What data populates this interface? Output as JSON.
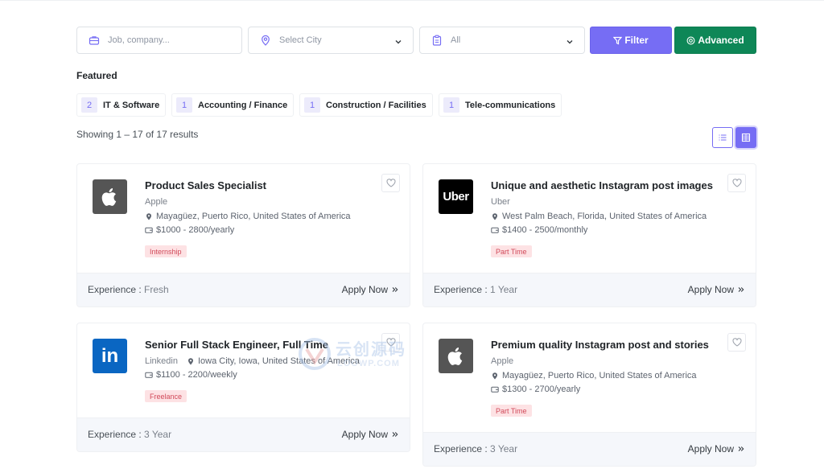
{
  "search": {
    "keyword_placeholder": "Job, company...",
    "city_value": "Select City",
    "category_value": "All",
    "filter_label": "Filter",
    "advanced_label": "Advanced"
  },
  "featured": {
    "title": "Featured",
    "chips": [
      {
        "count": "2",
        "name": "IT & Software"
      },
      {
        "count": "1",
        "name": "Accounting / Finance"
      },
      {
        "count": "1",
        "name": "Construction / Facilities"
      },
      {
        "count": "1",
        "name": "Tele-communications"
      }
    ]
  },
  "results": {
    "showing": "Showing 1 – 17 of 17 results"
  },
  "colors": {
    "accent": "#766df4",
    "advanced": "#0e8757",
    "tag_bg": "#fde2e4",
    "tag_text": "#d14a5a"
  },
  "jobs": [
    {
      "title": "Product Sales Specialist",
      "company": "Apple",
      "logo": "apple-logo",
      "location": "Mayagüez, Puerto Rico, United States of America",
      "salary": "$1000 - 2800/yearly",
      "type": "Internship",
      "experience_label": "Experience :",
      "experience": "Fresh",
      "apply": "Apply Now"
    },
    {
      "title": "Unique and aesthetic Instagram post images",
      "company": "Uber",
      "logo": "uber-logo",
      "logo_text": "Uber",
      "location": "West Palm Beach, Florida, United States of America",
      "salary": "$1400 - 2500/monthly",
      "type": "Part Time",
      "experience_label": "Experience :",
      "experience": "1 Year",
      "apply": "Apply Now"
    },
    {
      "title": "Senior Full Stack Engineer, Full Time",
      "company": "Linkedin",
      "logo": "linkedin-logo",
      "logo_text": "in",
      "location": "Iowa City, Iowa, United States of America",
      "salary": "$1100 - 2200/weekly",
      "type": "Freelance",
      "experience_label": "Experience :",
      "experience": "3 Year",
      "apply": "Apply Now"
    },
    {
      "title": "Premium quality Instagram post and stories",
      "company": "Apple",
      "logo": "apple-logo",
      "location": "Mayagüez, Puerto Rico, United States of America",
      "salary": "$1300 - 2700/yearly",
      "type": "Part Time",
      "experience_label": "Experience :",
      "experience": "3 Year",
      "apply": "Apply Now"
    }
  ],
  "watermark": {
    "main": "云创源码",
    "sub": "LOOWP.COM"
  }
}
